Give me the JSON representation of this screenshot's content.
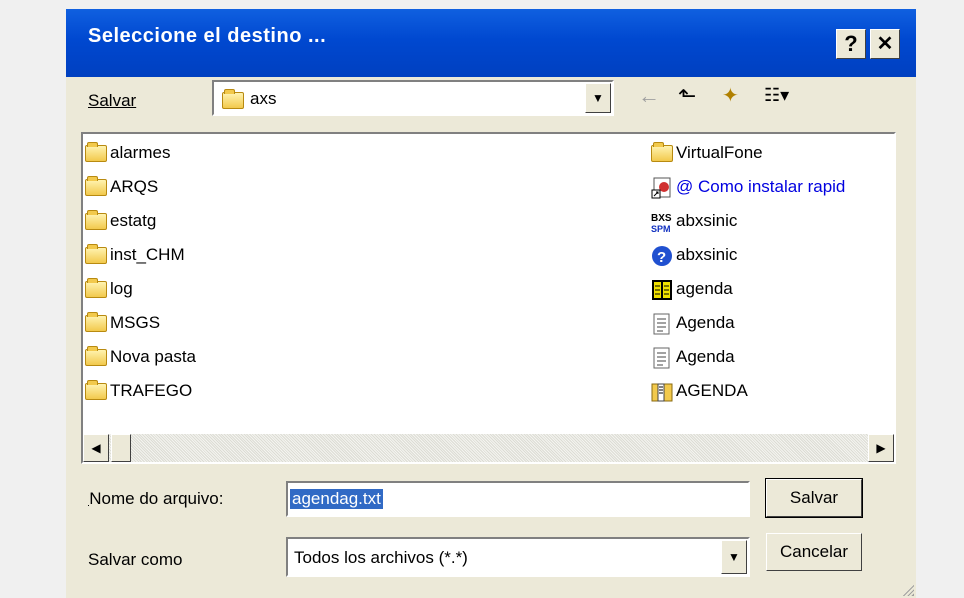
{
  "window": {
    "title": "Seleccione el destino ...",
    "help_label": "?",
    "close_label": "✕",
    "accent": "#0048d0"
  },
  "save_in": {
    "label": "Salvar",
    "value": "axs"
  },
  "toolbar": {
    "back": "←",
    "up_folder": "⬑",
    "new_folder": "✦",
    "view_menu": "☷▾"
  },
  "files_left": [
    {
      "name": "alarmes",
      "icon": "folder-icon"
    },
    {
      "name": "ARQS",
      "icon": "folder-icon"
    },
    {
      "name": "estatg",
      "icon": "folder-icon"
    },
    {
      "name": "inst_CHM",
      "icon": "folder-icon"
    },
    {
      "name": "log",
      "icon": "folder-icon"
    },
    {
      "name": "MSGS",
      "icon": "folder-icon"
    },
    {
      "name": "Nova pasta",
      "icon": "folder-icon"
    },
    {
      "name": "TRAFEGO",
      "icon": "folder-icon"
    }
  ],
  "files_right": [
    {
      "name": "VirtualFone",
      "icon": "folder-icon"
    },
    {
      "name": "@ Como instalar rapid",
      "icon": "shortcut-icon"
    },
    {
      "name": "abxsinic",
      "icon": "bxs-icon"
    },
    {
      "name": "abxsinic",
      "icon": "help-file-icon"
    },
    {
      "name": "agenda",
      "icon": "book-icon"
    },
    {
      "name": "Agenda",
      "icon": "text-file-icon"
    },
    {
      "name": "Agenda",
      "icon": "text-file-icon"
    },
    {
      "name": "AGENDA",
      "icon": "zip-folder-icon"
    }
  ],
  "file_name": {
    "label": "Nome do arquivo:",
    "value": "agendag.txt"
  },
  "save_as": {
    "label": "Salvar como",
    "value": "Todos los archivos (*.*)"
  },
  "buttons": {
    "save": "Salvar",
    "cancel": "Cancelar"
  }
}
